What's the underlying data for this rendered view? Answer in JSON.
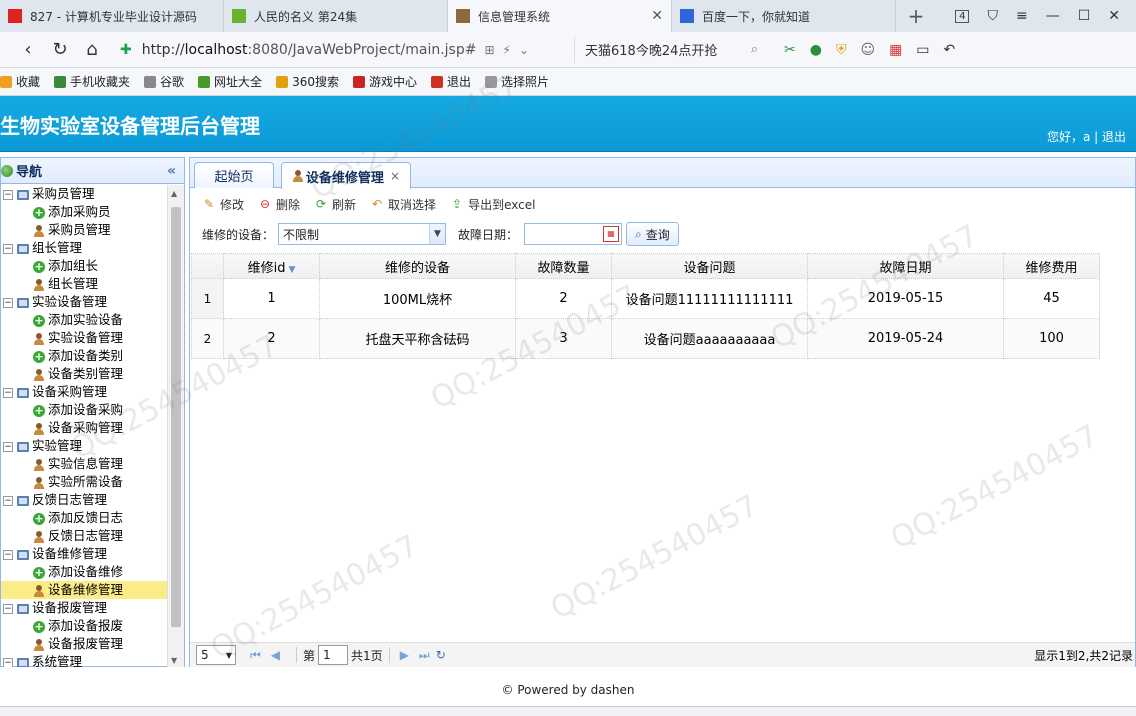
{
  "browser": {
    "tabs": [
      {
        "title": "827 - 计算机专业毕业设计源码",
        "color": "#d22"
      },
      {
        "title": "人民的名义 第24集",
        "color": "#6bb32e"
      },
      {
        "title": "信息管理系统",
        "color": "#8a6a3a",
        "active": true
      },
      {
        "title": "百度一下，你就知道",
        "color": "#2d66d8"
      }
    ],
    "tab_count": "4",
    "url_scheme": "http://",
    "url_host": "localhost",
    "url_path": ":8080/JavaWebProject/main.jsp#",
    "search_text": "天猫618今晚24点开抢",
    "bookmarks": [
      {
        "label": "收藏",
        "color": "#f0a020"
      },
      {
        "label": "手机收藏夹",
        "color": "#3a8a3a"
      },
      {
        "label": "谷歌",
        "color": "#888"
      },
      {
        "label": "网址大全",
        "color": "#4a9a2a"
      },
      {
        "label": "360搜索",
        "color": "#e0a010"
      },
      {
        "label": "游戏中心",
        "color": "#cc2222"
      },
      {
        "label": "退出",
        "color": "#d03020"
      },
      {
        "label": "选择照片",
        "color": "#999"
      }
    ]
  },
  "app": {
    "title": "生物实验室设备管理后台管理",
    "greeting": "您好，a | 退出"
  },
  "nav": {
    "title": "导航",
    "collapse": "«",
    "groups": [
      {
        "label": "采购员管理",
        "items": [
          "添加采购员",
          "采购员管理"
        ],
        "kinds": [
          "add",
          "user"
        ]
      },
      {
        "label": "组长管理",
        "items": [
          "添加组长",
          "组长管理"
        ],
        "kinds": [
          "add",
          "user"
        ]
      },
      {
        "label": "实验设备管理",
        "items": [
          "添加实验设备",
          "实验设备管理",
          "添加设备类别",
          "设备类别管理"
        ],
        "kinds": [
          "add",
          "user",
          "add",
          "user"
        ]
      },
      {
        "label": "设备采购管理",
        "items": [
          "添加设备采购",
          "设备采购管理"
        ],
        "kinds": [
          "add",
          "user"
        ]
      },
      {
        "label": "实验管理",
        "items": [
          "实验信息管理",
          "实验所需设备"
        ],
        "kinds": [
          "user",
          "user"
        ]
      },
      {
        "label": "反馈日志管理",
        "items": [
          "添加反馈日志",
          "反馈日志管理"
        ],
        "kinds": [
          "add",
          "user"
        ]
      },
      {
        "label": "设备维修管理",
        "items": [
          "添加设备维修",
          "设备维修管理"
        ],
        "kinds": [
          "add",
          "user"
        ]
      },
      {
        "label": "设备报废管理",
        "items": [
          "添加设备报废",
          "设备报废管理"
        ],
        "kinds": [
          "add",
          "user"
        ]
      },
      {
        "label": "系统管理",
        "items": [],
        "kinds": []
      }
    ],
    "selected": "设备维修管理"
  },
  "main": {
    "tab_home": "起始页",
    "tab_active": "设备维修管理",
    "toolbar": {
      "edit": "修改",
      "delete": "删除",
      "refresh": "刷新",
      "cancel": "取消选择",
      "export": "导出到excel"
    },
    "filter": {
      "device_label": "维修的设备：",
      "device_value": "不限制",
      "date_label": "故障日期：",
      "date_value": "",
      "query": "查询"
    },
    "columns": [
      "维修id",
      "维修的设备",
      "故障数量",
      "设备问题",
      "故障日期",
      "维修费用"
    ],
    "rows": [
      [
        "1",
        "100ML烧杯",
        "2",
        "设备问题11111111111111",
        "2019-05-15",
        "45"
      ],
      [
        "2",
        "托盘天平称含砝码",
        "3",
        "设备问题aaaaaaaaaa",
        "2019-05-24",
        "100"
      ]
    ],
    "pager": {
      "page_size": "5",
      "page_prefix": "第",
      "page_num": "1",
      "page_suffix": "共1页",
      "info": "显示1到2,共2记录"
    }
  },
  "footer": "© Powered by dashen"
}
